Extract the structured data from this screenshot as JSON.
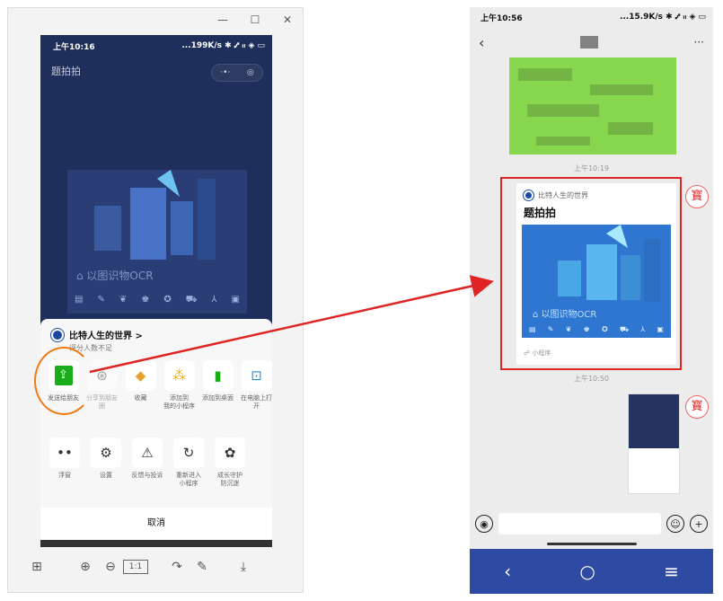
{
  "left": {
    "window_controls": [
      "—",
      "☐",
      "✕"
    ],
    "status_time": "上午10:16",
    "status_right": "...199K/s ✱ ⑇ ᵢₗ ◈ ▭",
    "page_title": "题拍拍",
    "capsule_dots": "·•·",
    "capsule_target": "◎",
    "illus_text": "⌂ 以图识物OCR",
    "illus_icons": [
      "▤",
      "✎",
      "❦",
      "♚",
      "✪",
      "⛟",
      "⅄",
      "▣"
    ],
    "sheet": {
      "name": "比特人生的世界 >",
      "sub": "评分人数不足",
      "row1": [
        {
          "icon": "⇪",
          "label": "发送给朋友",
          "dim": false
        },
        {
          "icon": "⊛",
          "label": "分享到朋友圈",
          "dim": true
        },
        {
          "icon": "◆",
          "label": "收藏",
          "dim": false
        },
        {
          "icon": "⁂",
          "label": "添加到\n我的小程序",
          "dim": false
        },
        {
          "icon": "▮",
          "label": "添加到桌面",
          "dim": false
        },
        {
          "icon": "⊡",
          "label": "在电脑上打开",
          "dim": false
        }
      ],
      "row2": [
        {
          "icon": "••",
          "label": "浮窗"
        },
        {
          "icon": "⚙",
          "label": "设置"
        },
        {
          "icon": "⚠",
          "label": "反馈与投诉"
        },
        {
          "icon": "↻",
          "label": "重新进入\n小程序"
        },
        {
          "icon": "✿",
          "label": "成长守护\n防沉迷"
        }
      ],
      "cancel": "取消"
    },
    "toolbar": [
      "⊞",
      "⊕",
      "⊖",
      "1:1",
      "↷",
      "✎",
      "⤓"
    ]
  },
  "right": {
    "status_time": "上午10:56",
    "status_right": "...15.9K/s ✱ ⑇ ᵢₗ ◈ ▭",
    "back": "‹",
    "more": "···",
    "ts1": "上午10:19",
    "card": {
      "source": "比特人生的世界",
      "title": "题拍拍",
      "img_text": "⌂ 以图识物OCR",
      "img_icons": [
        "▤",
        "✎",
        "❦",
        "♚",
        "✪",
        "⛟",
        "⅄",
        "▣"
      ],
      "footer": "☍ 小程序"
    },
    "ts2": "上午10:50",
    "avatar": "寳",
    "voice": "◉",
    "emoji": "☺",
    "plus": "+",
    "nav": [
      "‹",
      "○",
      "≡"
    ]
  },
  "colors": {
    "accent_red": "#e02323",
    "annotation_orange": "#f07b16",
    "nav_blue": "#2e4aa2"
  }
}
